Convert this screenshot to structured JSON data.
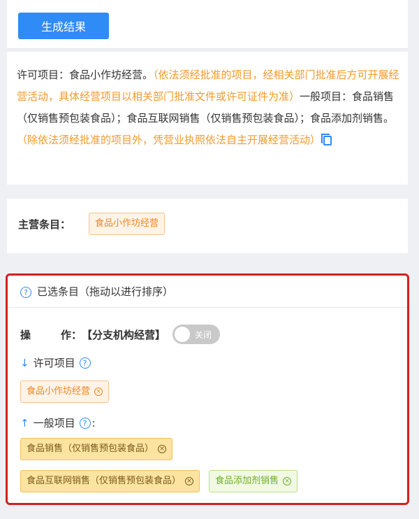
{
  "generate": {
    "button_label": "生成结果"
  },
  "scope": {
    "p1": "许可项目：食品小作坊经营。",
    "p2": "（依法须经批准的项目，经相关部门批准后方可开展经营活动，具体经营项目以相关部门批准文件或许可证件为准）",
    "p3": "一般项目：食品销售（仅销售预包装食品）；食品互联网销售（仅销售预包装食品）；食品添加剂销售。",
    "p4": "（除依法须经批准的项目外，凭营业执照依法自主开展经营活动）"
  },
  "main_item": {
    "label": "主营条目：",
    "tag": "食品小作坊经营"
  },
  "selected": {
    "title": "已选条目（拖动以进行排序）",
    "operation_label": "操",
    "operation_label2": "作：",
    "operation_value": "【分支机构经营】",
    "toggle_text": "关闭",
    "licensed_label": "许可项目",
    "licensed_items": [
      "食品小作坊经营"
    ],
    "general_label": "一般项目",
    "general_items": [
      "食品销售（仅销售预包装食品）",
      "食品互联网销售（仅销售预包装食品）",
      "食品添加剂销售"
    ]
  },
  "colors": {
    "primary": "#2f8bf5",
    "highlight_border": "#d32020",
    "orange": "#f39a2b"
  }
}
